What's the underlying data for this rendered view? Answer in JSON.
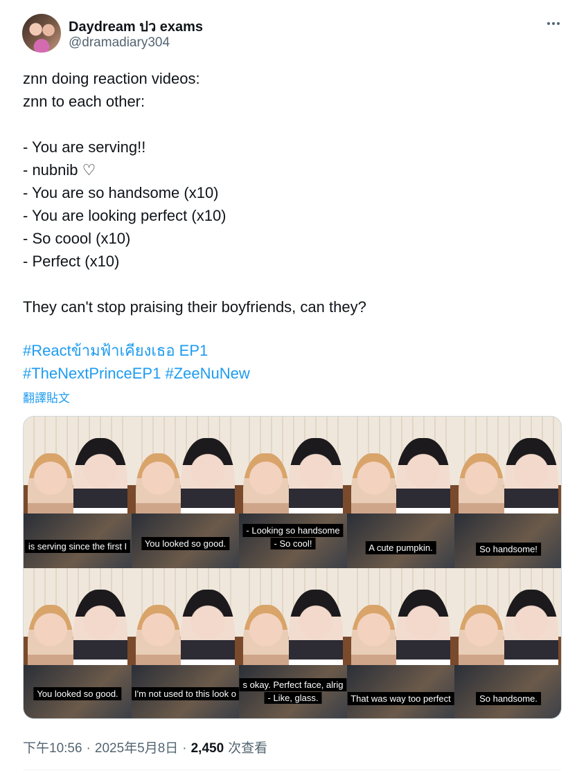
{
  "author": {
    "display_name": "Daydream ปว exams",
    "handle": "@dramadiary304"
  },
  "body_lines": [
    "znn doing reaction videos:",
    "znn to each other:",
    "",
    "- You are serving!!",
    "- nubnib ♡",
    "- You are so handsome (x10)",
    "- You are looking perfect (x10)",
    "- So coool (x10)",
    "- Perfect (x10)",
    "",
    "They can't stop praising their boyfriends, can they?"
  ],
  "hashtags": {
    "line1": "#Reactข้ามฟ้าเคียงเธอ EP1",
    "line2a": "#TheNextPrinceEP1",
    "line2b": "#ZeeNuNew"
  },
  "translate_label": "翻譯貼文",
  "media": {
    "captions": [
      "is serving since the first I",
      "You looked so good.",
      "- Looking so handsome",
      "- So cool!",
      "A cute pumpkin.",
      "So handsome!",
      "You looked so good.",
      "I'm not used to this look o",
      "s okay. Perfect face, alrig",
      "- Like, glass.",
      "That was way too perfect",
      "So handsome."
    ]
  },
  "meta": {
    "time": "下午10:56",
    "date": "2025年5月8日",
    "separator": "·",
    "views_count": "2,450",
    "views_label": "次查看"
  }
}
